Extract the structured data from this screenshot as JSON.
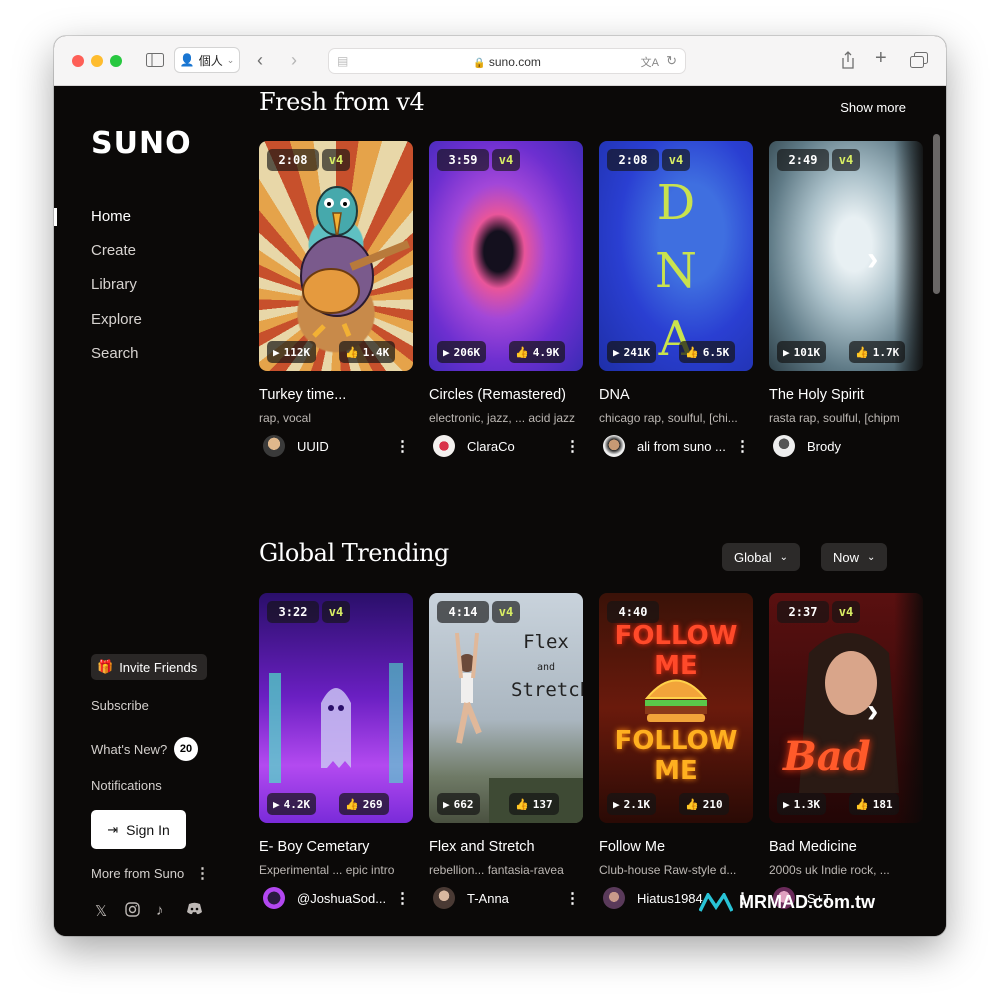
{
  "browser": {
    "profile": "個人",
    "url": "suno.com",
    "lights": {
      "close": "#fe5f57",
      "minimize": "#febc2e",
      "maximize": "#28c840"
    }
  },
  "sidebar": {
    "logo": "SUNO",
    "nav": [
      {
        "label": "Home"
      },
      {
        "label": "Create"
      },
      {
        "label": "Library"
      },
      {
        "label": "Explore"
      },
      {
        "label": "Search"
      }
    ],
    "invite": "Invite Friends",
    "subscribe": "Subscribe",
    "whats_new": "What's New?",
    "whats_new_count": "20",
    "notifications": "Notifications",
    "sign_in": "Sign In",
    "more_from": "More from Suno",
    "social_icons": [
      "x-icon",
      "instagram-icon",
      "tiktok-icon",
      "discord-icon"
    ]
  },
  "fresh": {
    "title": "Fresh from v4",
    "show_more": "Show more",
    "cards": [
      {
        "duration": "2:08",
        "version": "v4",
        "plays": "112K",
        "likes": "1.4K",
        "title": "Turkey time...",
        "tags": "rap, vocal",
        "user": "UUID"
      },
      {
        "duration": "3:59",
        "version": "v4",
        "plays": "206K",
        "likes": "4.9K",
        "title": "Circles (Remastered)",
        "tags": "electronic, jazz, ... acid jazz",
        "user": "ClaraCo"
      },
      {
        "duration": "2:08",
        "version": "v4",
        "plays": "241K",
        "likes": "6.5K",
        "title": "DNA",
        "tags": "chicago rap, soulful, [chi...",
        "user": "ali from suno ...",
        "art_text": "DNA"
      },
      {
        "duration": "2:49",
        "version": "v4",
        "plays": "101K",
        "likes": "1.7K",
        "title": "The Holy Spirit",
        "tags": "rasta rap, soulful, [chipm",
        "user": "Brody"
      }
    ]
  },
  "trending": {
    "title": "Global Trending",
    "filter_scope": "Global",
    "filter_time": "Now",
    "cards": [
      {
        "duration": "3:22",
        "version": "v4",
        "plays": "4.2K",
        "likes": "269",
        "title": "E- Boy Cemetary",
        "tags": "Experimental ... epic intro",
        "user": "@JoshuaSod..."
      },
      {
        "duration": "4:14",
        "version": "v4",
        "plays": "662",
        "likes": "137",
        "title": "Flex and Stretch",
        "tags": "rebellion... fantasia-ravea",
        "user": "T-Anna",
        "art_text": "Flex and Stretch"
      },
      {
        "duration": "4:40",
        "version": "",
        "plays": "2.1K",
        "likes": "210",
        "title": "Follow Me",
        "tags": "Club-house Raw-style d...",
        "user": "Hiatus1984",
        "art_text": "FOLLOW ME"
      },
      {
        "duration": "2:37",
        "version": "v4",
        "plays": "1.3K",
        "likes": "181",
        "title": "Bad Medicine",
        "tags": "2000s uk Indie rock, ...",
        "user": "S+T",
        "art_text": "Bad"
      }
    ]
  },
  "watermark": "MRMAD.com.tw"
}
